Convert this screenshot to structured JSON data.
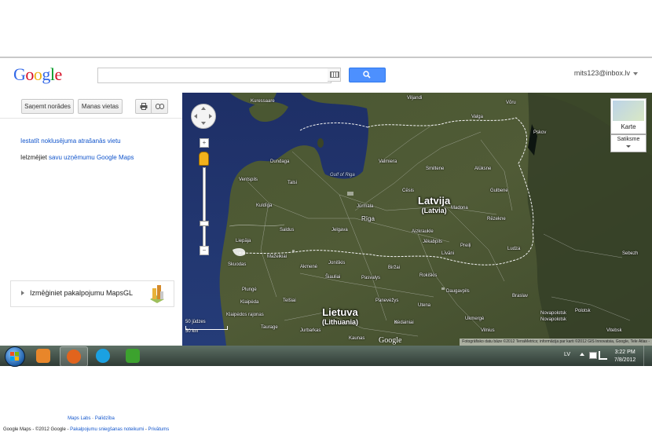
{
  "header": {
    "logo_letters": [
      {
        "ch": "G",
        "color": "#3369e8"
      },
      {
        "ch": "o",
        "color": "#d50f25"
      },
      {
        "ch": "o",
        "color": "#eeb211"
      },
      {
        "ch": "g",
        "color": "#3369e8"
      },
      {
        "ch": "l",
        "color": "#009925"
      },
      {
        "ch": "e",
        "color": "#d50f25"
      }
    ],
    "search_value": "",
    "account": "mits123@inbox.lv"
  },
  "left_panel": {
    "directions_button": "Saņemt norādes",
    "my_places_button": "Manas vietas",
    "set_location_link": "Iestatīt noklusējuma atrašanās vietu",
    "put_prefix": "Ielzmējiet",
    "put_link": "savu uzņēmumu Google Maps",
    "promo_text": "Izmēģiniet pakalpojumu MapsGL",
    "footer_labs": "Maps Labs",
    "footer_help": "Palīdzība",
    "footer_copyright": "Google Maps - ©2012 Google -",
    "footer_terms": "Pakalpojumu sniegšanas noteikumi",
    "footer_privacy": "Privātums"
  },
  "map": {
    "labels": [
      {
        "text": "Kuressaare"
      },
      {
        "text": "Viljandi"
      },
      {
        "text": "Võru"
      },
      {
        "text": "Valga"
      },
      {
        "text": "Pskov"
      },
      {
        "text": "Dundaga"
      },
      {
        "text": "Valmiera"
      },
      {
        "text": "Smiltene"
      },
      {
        "text": "Alūksne"
      },
      {
        "text": "Ventspils"
      },
      {
        "text": "Talsi"
      },
      {
        "text": "Gulbene"
      },
      {
        "text": "Cēsis"
      },
      {
        "text": "Kuldīga"
      },
      {
        "text": "Jūrmala"
      },
      {
        "text": "Rīga"
      },
      {
        "text": "Madona"
      },
      {
        "text": "Rēzekne"
      },
      {
        "text": "Saldus"
      },
      {
        "text": "Jelgava"
      },
      {
        "text": "Aizkraukle"
      },
      {
        "text": "Liepāja"
      },
      {
        "text": "Jēkabpils"
      },
      {
        "text": "Preiļi"
      },
      {
        "text": "Ludza"
      },
      {
        "text": "Mažeikiai"
      },
      {
        "text": "Skuodas"
      },
      {
        "text": "Joniškis"
      },
      {
        "text": "Biržai"
      },
      {
        "text": "Līvāni"
      },
      {
        "text": "Sebezh"
      },
      {
        "text": "Akmenė"
      },
      {
        "text": "Pasvalys"
      },
      {
        "text": "Rokiškis"
      },
      {
        "text": "Daugavpils"
      },
      {
        "text": "Plungė"
      },
      {
        "text": "Šiauliai"
      },
      {
        "text": "Panevėžys"
      },
      {
        "text": "Utena"
      },
      {
        "text": "Braslav"
      },
      {
        "text": "Klaipėda"
      },
      {
        "text": "Telšiai"
      },
      {
        "text": "Kėdainiai"
      },
      {
        "text": "Ukmergė"
      },
      {
        "text": "Novapolotsk"
      },
      {
        "text": "Klaipėdos rajonas"
      },
      {
        "text": "Taurage"
      },
      {
        "text": "Jurbarkas"
      },
      {
        "text": "Kaunas"
      },
      {
        "text": "Vilnius"
      },
      {
        "text": "Polotsk"
      },
      {
        "text": "Vitebsk"
      },
      {
        "text": "Gulf of Riga"
      },
      {
        "text": "Novapolotsk"
      }
    ],
    "country_latvia": "Latvija",
    "country_latvia_sub": "(Latvia)",
    "country_lithuania": "Lietuva",
    "country_lithuania_sub": "(Lithuania)",
    "maptype_map": "Karte",
    "maptype_satellite": "Satiksme",
    "scale_mi": "50 jūdzes",
    "scale_km": "50 km",
    "attribution": "Fotogrāfisko datu bāze ©2012 TerraMetrics; informācija par karti ©2012 GIS Innovatsia, Google, Tele Atlas -",
    "google_mark": "Google",
    "zoom_in": "+",
    "zoom_out": "−"
  },
  "taskbar": {
    "language": "LV",
    "time": "3:22 PM",
    "date": "7/8/2012",
    "apps": [
      {
        "name": "media-player-icon",
        "color": "#e8862a"
      },
      {
        "name": "firefox-icon",
        "color": "#e2641d"
      },
      {
        "name": "skype-icon",
        "color": "#1ba1e2"
      },
      {
        "name": "utorrent-icon",
        "color": "#3ca22e"
      }
    ]
  }
}
